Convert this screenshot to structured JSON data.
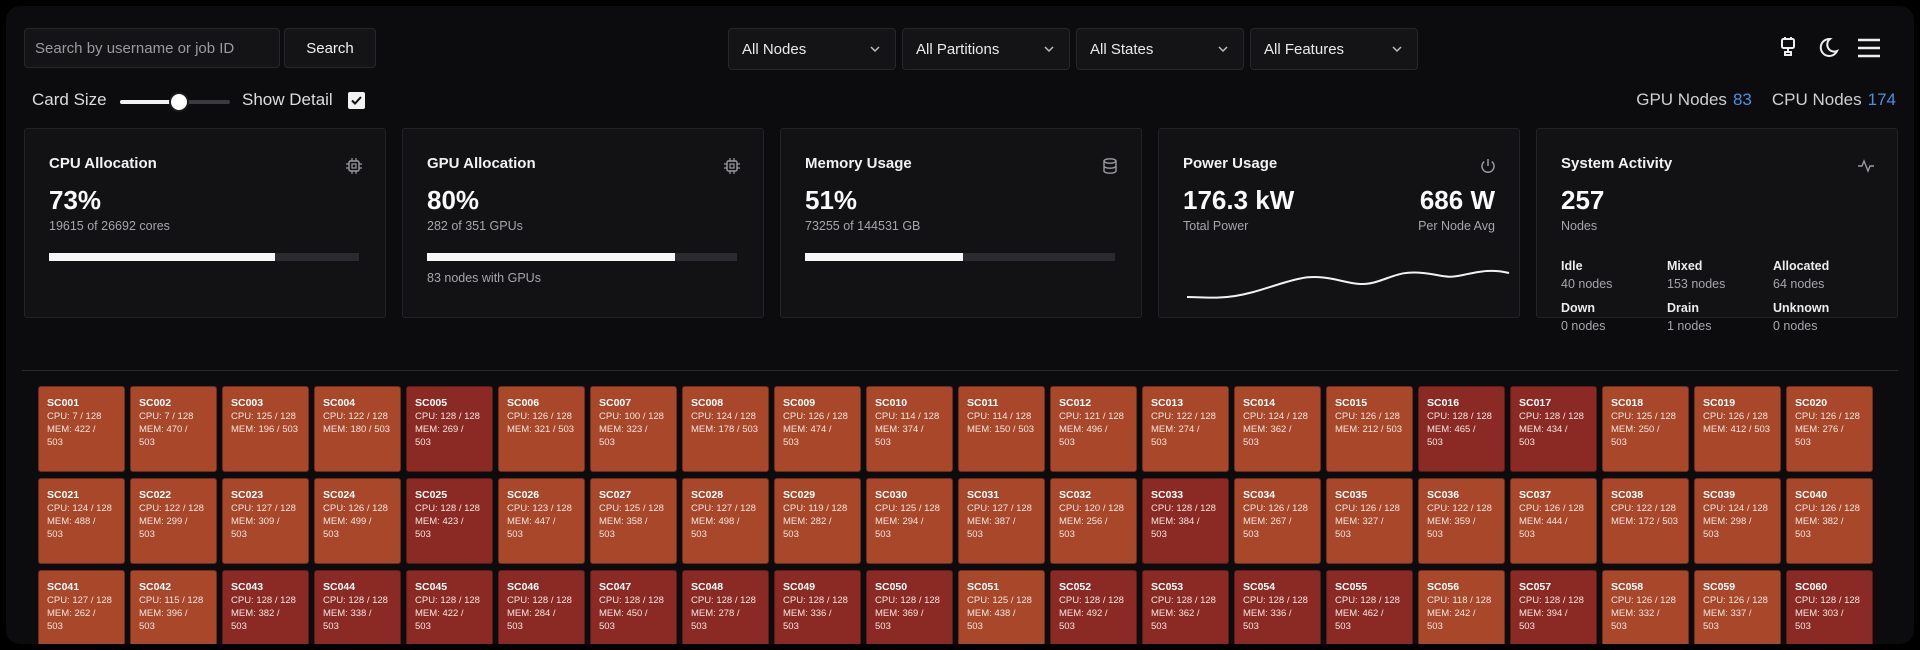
{
  "search": {
    "placeholder": "Search by username or job ID",
    "button": "Search"
  },
  "filters": [
    "All Nodes",
    "All Partitions",
    "All States",
    "All Features"
  ],
  "toolbar_icons": [
    "plug-icon",
    "moon-icon",
    "menu-icon"
  ],
  "controls": {
    "card_size_label": "Card Size",
    "card_size_value": 0.47,
    "show_detail_label": "Show Detail",
    "show_detail_checked": true
  },
  "counts": {
    "gpu_label": "GPU Nodes",
    "gpu_value": "83",
    "cpu_label": "CPU Nodes",
    "cpu_value": "174"
  },
  "colors": {
    "accent_blue": "#4a8fe2",
    "node_allocated": "#8b2a24",
    "node_mixed": "#a8472a",
    "background": "#0c0c0e"
  },
  "cards": {
    "cpu": {
      "title": "CPU Allocation",
      "value": "73%",
      "sub": "19615 of 26692 cores",
      "fraction": 0.73,
      "icon": "cpu-icon"
    },
    "gpu": {
      "title": "GPU Allocation",
      "value": "80%",
      "sub": "282 of 351 GPUs",
      "fraction": 0.8,
      "note": "83 nodes with GPUs",
      "icon": "gpu-chip-icon"
    },
    "memory": {
      "title": "Memory Usage",
      "value": "51%",
      "sub": "73255 of 144531 GB",
      "fraction": 0.51,
      "icon": "database-icon"
    },
    "power": {
      "title": "Power Usage",
      "total": "176.3 kW",
      "total_label": "Total Power",
      "avg": "686 W",
      "avg_label": "Per Node Avg",
      "icon": "power-icon"
    },
    "activity": {
      "title": "System Activity",
      "value": "257",
      "sub": "Nodes",
      "icon": "activity-icon",
      "states": [
        {
          "label": "Idle",
          "value": "40 nodes"
        },
        {
          "label": "Mixed",
          "value": "153 nodes"
        },
        {
          "label": "Allocated",
          "value": "64 nodes"
        },
        {
          "label": "Down",
          "value": "0 nodes"
        },
        {
          "label": "Drain",
          "value": "1 nodes"
        },
        {
          "label": "Unknown",
          "value": "0 nodes"
        }
      ]
    }
  },
  "nodes": [
    {
      "id": "SC001",
      "cpu": "CPU: 7 / 128",
      "mem": "MEM: 422 /",
      "mem2": "503",
      "state": "mixed"
    },
    {
      "id": "SC002",
      "cpu": "CPU: 7 / 128",
      "mem": "MEM: 470 /",
      "mem2": "503",
      "state": "mixed"
    },
    {
      "id": "SC003",
      "cpu": "CPU: 125 / 128",
      "mem": "MEM: 196 / 503",
      "mem2": "",
      "state": "mixed"
    },
    {
      "id": "SC004",
      "cpu": "CPU: 122 / 128",
      "mem": "MEM: 180 / 503",
      "mem2": "",
      "state": "mixed"
    },
    {
      "id": "SC005",
      "cpu": "CPU: 128 / 128",
      "mem": "MEM: 269 /",
      "mem2": "503",
      "state": "allocated"
    },
    {
      "id": "SC006",
      "cpu": "CPU: 126 / 128",
      "mem": "MEM: 321 / 503",
      "mem2": "",
      "state": "mixed"
    },
    {
      "id": "SC007",
      "cpu": "CPU: 100 / 128",
      "mem": "MEM: 323 /",
      "mem2": "503",
      "state": "mixed"
    },
    {
      "id": "SC008",
      "cpu": "CPU: 124 / 128",
      "mem": "MEM: 178 / 503",
      "mem2": "",
      "state": "mixed"
    },
    {
      "id": "SC009",
      "cpu": "CPU: 126 / 128",
      "mem": "MEM: 474 /",
      "mem2": "503",
      "state": "mixed"
    },
    {
      "id": "SC010",
      "cpu": "CPU: 114 / 128",
      "mem": "MEM: 374 /",
      "mem2": "503",
      "state": "mixed"
    },
    {
      "id": "SC011",
      "cpu": "CPU: 114 / 128",
      "mem": "MEM: 150 / 503",
      "mem2": "",
      "state": "mixed"
    },
    {
      "id": "SC012",
      "cpu": "CPU: 121 / 128",
      "mem": "MEM: 496 /",
      "mem2": "503",
      "state": "mixed"
    },
    {
      "id": "SC013",
      "cpu": "CPU: 122 / 128",
      "mem": "MEM: 274 /",
      "mem2": "503",
      "state": "mixed"
    },
    {
      "id": "SC014",
      "cpu": "CPU: 124 / 128",
      "mem": "MEM: 362 /",
      "mem2": "503",
      "state": "mixed"
    },
    {
      "id": "SC015",
      "cpu": "CPU: 126 / 128",
      "mem": "MEM: 212 / 503",
      "mem2": "",
      "state": "mixed"
    },
    {
      "id": "SC016",
      "cpu": "CPU: 128 / 128",
      "mem": "MEM: 465 /",
      "mem2": "503",
      "state": "allocated"
    },
    {
      "id": "SC017",
      "cpu": "CPU: 128 / 128",
      "mem": "MEM: 434 /",
      "mem2": "503",
      "state": "allocated"
    },
    {
      "id": "SC018",
      "cpu": "CPU: 125 / 128",
      "mem": "MEM: 250 /",
      "mem2": "503",
      "state": "mixed"
    },
    {
      "id": "SC019",
      "cpu": "CPU: 126 / 128",
      "mem": "MEM: 412 / 503",
      "mem2": "",
      "state": "mixed"
    },
    {
      "id": "SC020",
      "cpu": "CPU: 126 / 128",
      "mem": "MEM: 276 /",
      "mem2": "503",
      "state": "mixed"
    },
    {
      "id": "SC021",
      "cpu": "CPU: 124 / 128",
      "mem": "MEM: 488 /",
      "mem2": "503",
      "state": "mixed"
    },
    {
      "id": "SC022",
      "cpu": "CPU: 122 / 128",
      "mem": "MEM: 299 /",
      "mem2": "503",
      "state": "mixed"
    },
    {
      "id": "SC023",
      "cpu": "CPU: 127 / 128",
      "mem": "MEM: 309 /",
      "mem2": "503",
      "state": "mixed"
    },
    {
      "id": "SC024",
      "cpu": "CPU: 126 / 128",
      "mem": "MEM: 499 /",
      "mem2": "503",
      "state": "mixed"
    },
    {
      "id": "SC025",
      "cpu": "CPU: 128 / 128",
      "mem": "MEM: 423 /",
      "mem2": "503",
      "state": "allocated"
    },
    {
      "id": "SC026",
      "cpu": "CPU: 123 / 128",
      "mem": "MEM: 447 /",
      "mem2": "503",
      "state": "mixed"
    },
    {
      "id": "SC027",
      "cpu": "CPU: 125 / 128",
      "mem": "MEM: 358 /",
      "mem2": "503",
      "state": "mixed"
    },
    {
      "id": "SC028",
      "cpu": "CPU: 127 / 128",
      "mem": "MEM: 498 /",
      "mem2": "503",
      "state": "mixed"
    },
    {
      "id": "SC029",
      "cpu": "CPU: 119 / 128",
      "mem": "MEM: 282 /",
      "mem2": "503",
      "state": "mixed"
    },
    {
      "id": "SC030",
      "cpu": "CPU: 125 / 128",
      "mem": "MEM: 294 /",
      "mem2": "503",
      "state": "mixed"
    },
    {
      "id": "SC031",
      "cpu": "CPU: 127 / 128",
      "mem": "MEM: 387 /",
      "mem2": "503",
      "state": "mixed"
    },
    {
      "id": "SC032",
      "cpu": "CPU: 120 / 128",
      "mem": "MEM: 256 /",
      "mem2": "503",
      "state": "mixed"
    },
    {
      "id": "SC033",
      "cpu": "CPU: 128 / 128",
      "mem": "MEM: 384 /",
      "mem2": "503",
      "state": "allocated"
    },
    {
      "id": "SC034",
      "cpu": "CPU: 126 / 128",
      "mem": "MEM: 267 /",
      "mem2": "503",
      "state": "mixed"
    },
    {
      "id": "SC035",
      "cpu": "CPU: 126 / 128",
      "mem": "MEM: 327 /",
      "mem2": "503",
      "state": "mixed"
    },
    {
      "id": "SC036",
      "cpu": "CPU: 122 / 128",
      "mem": "MEM: 359 /",
      "mem2": "503",
      "state": "mixed"
    },
    {
      "id": "SC037",
      "cpu": "CPU: 126 / 128",
      "mem": "MEM: 444 /",
      "mem2": "503",
      "state": "mixed"
    },
    {
      "id": "SC038",
      "cpu": "CPU: 122 / 128",
      "mem": "MEM: 172 / 503",
      "mem2": "",
      "state": "mixed"
    },
    {
      "id": "SC039",
      "cpu": "CPU: 124 / 128",
      "mem": "MEM: 298 /",
      "mem2": "503",
      "state": "mixed"
    },
    {
      "id": "SC040",
      "cpu": "CPU: 126 / 128",
      "mem": "MEM: 382 /",
      "mem2": "503",
      "state": "mixed"
    },
    {
      "id": "SC041",
      "cpu": "CPU: 127 / 128",
      "mem": "MEM: 262 /",
      "mem2": "503",
      "state": "mixed"
    },
    {
      "id": "SC042",
      "cpu": "CPU: 115 / 128",
      "mem": "MEM: 396 /",
      "mem2": "503",
      "state": "mixed"
    },
    {
      "id": "SC043",
      "cpu": "CPU: 128 / 128",
      "mem": "MEM: 382 /",
      "mem2": "503",
      "state": "allocated"
    },
    {
      "id": "SC044",
      "cpu": "CPU: 128 / 128",
      "mem": "MEM: 338 /",
      "mem2": "503",
      "state": "allocated"
    },
    {
      "id": "SC045",
      "cpu": "CPU: 128 / 128",
      "mem": "MEM: 422 /",
      "mem2": "503",
      "state": "allocated"
    },
    {
      "id": "SC046",
      "cpu": "CPU: 128 / 128",
      "mem": "MEM: 284 /",
      "mem2": "503",
      "state": "allocated"
    },
    {
      "id": "SC047",
      "cpu": "CPU: 128 / 128",
      "mem": "MEM: 450 /",
      "mem2": "503",
      "state": "allocated"
    },
    {
      "id": "SC048",
      "cpu": "CPU: 128 / 128",
      "mem": "MEM: 278 /",
      "mem2": "503",
      "state": "allocated"
    },
    {
      "id": "SC049",
      "cpu": "CPU: 128 / 128",
      "mem": "MEM: 336 /",
      "mem2": "503",
      "state": "allocated"
    },
    {
      "id": "SC050",
      "cpu": "CPU: 128 / 128",
      "mem": "MEM: 369 /",
      "mem2": "503",
      "state": "allocated"
    },
    {
      "id": "SC051",
      "cpu": "CPU: 125 / 128",
      "mem": "MEM: 438 /",
      "mem2": "503",
      "state": "mixed"
    },
    {
      "id": "SC052",
      "cpu": "CPU: 128 / 128",
      "mem": "MEM: 492 /",
      "mem2": "503",
      "state": "allocated"
    },
    {
      "id": "SC053",
      "cpu": "CPU: 128 / 128",
      "mem": "MEM: 362 /",
      "mem2": "503",
      "state": "allocated"
    },
    {
      "id": "SC054",
      "cpu": "CPU: 128 / 128",
      "mem": "MEM: 336 /",
      "mem2": "503",
      "state": "allocated"
    },
    {
      "id": "SC055",
      "cpu": "CPU: 128 / 128",
      "mem": "MEM: 462 /",
      "mem2": "503",
      "state": "allocated"
    },
    {
      "id": "SC056",
      "cpu": "CPU: 118 / 128",
      "mem": "MEM: 242 /",
      "mem2": "503",
      "state": "mixed"
    },
    {
      "id": "SC057",
      "cpu": "CPU: 128 / 128",
      "mem": "MEM: 394 /",
      "mem2": "503",
      "state": "allocated"
    },
    {
      "id": "SC058",
      "cpu": "CPU: 126 / 128",
      "mem": "MEM: 332 /",
      "mem2": "503",
      "state": "mixed"
    },
    {
      "id": "SC059",
      "cpu": "CPU: 126 / 128",
      "mem": "MEM: 337 /",
      "mem2": "503",
      "state": "mixed"
    },
    {
      "id": "SC060",
      "cpu": "CPU: 128 / 128",
      "mem": "MEM: 303 /",
      "mem2": "503",
      "state": "allocated"
    }
  ]
}
